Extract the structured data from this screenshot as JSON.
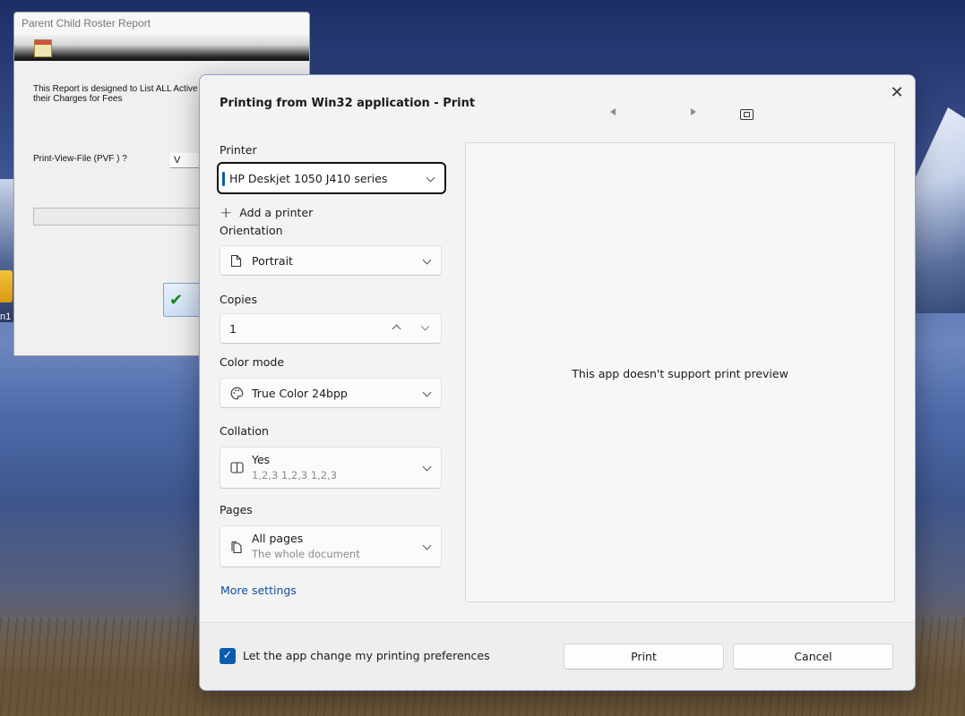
{
  "desktop": {
    "icon_label": "n1"
  },
  "legacy_window": {
    "title": "Parent Child Roster Report",
    "description_line1": "This Report is designed to List ALL Active",
    "description_line2": "their Charges for Fees",
    "pvf_label": "Print-View-File   (PVF ) ?",
    "pvf_value": "V",
    "ok_icon": "check-icon"
  },
  "print_dialog": {
    "title": "Printing from Win32 application - Print",
    "printer": {
      "label": "Printer",
      "value": "HP Deskjet 1050 J410 series"
    },
    "add_printer": "Add a printer",
    "orientation": {
      "label": "Orientation",
      "value": "Portrait",
      "icon": "page-icon"
    },
    "copies": {
      "label": "Copies",
      "value": "1"
    },
    "color_mode": {
      "label": "Color mode",
      "value": "True Color 24bpp",
      "icon": "palette-icon"
    },
    "collation": {
      "label": "Collation",
      "value": "Yes",
      "sub": "1,2,3   1,2,3   1,2,3",
      "icon": "collation-icon"
    },
    "pages": {
      "label": "Pages",
      "value": "All pages",
      "sub": "The whole document",
      "icon": "pages-icon"
    },
    "more_settings": "More settings",
    "preview_message": "This app doesn't support print preview",
    "footer": {
      "checkbox_checked": true,
      "checkbox_label": "Let the app change my printing preferences",
      "print_button": "Print",
      "cancel_button": "Cancel"
    }
  }
}
